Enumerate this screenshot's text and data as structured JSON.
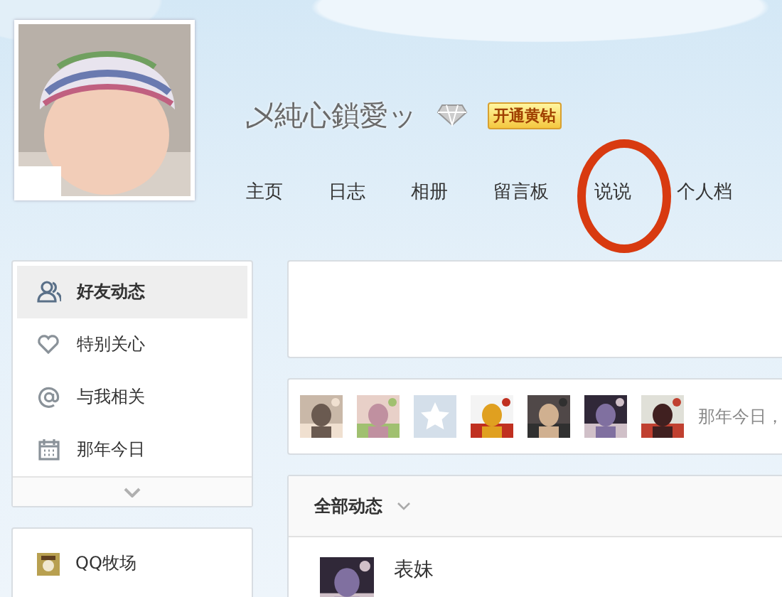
{
  "profile": {
    "name": "乄純心鎖愛ッ",
    "vip_badge": "开通黄钻"
  },
  "nav": [
    {
      "label": "主页",
      "selected": false
    },
    {
      "label": "日志",
      "selected": false
    },
    {
      "label": "相册",
      "selected": false
    },
    {
      "label": "留言板",
      "selected": false
    },
    {
      "label": "说说",
      "selected": false
    },
    {
      "label": "个人档",
      "selected": false
    }
  ],
  "sidebar": {
    "items": [
      {
        "label": "好友动态",
        "selected": true
      },
      {
        "label": "特别关心",
        "selected": false
      },
      {
        "label": "与我相关",
        "selected": false
      },
      {
        "label": "那年今日",
        "selected": false
      }
    ]
  },
  "apps": {
    "items": [
      {
        "label": "QQ牧场"
      }
    ]
  },
  "friend_avatars": [
    {
      "kind": "picture"
    },
    {
      "kind": "picture"
    },
    {
      "kind": "default"
    },
    {
      "kind": "picture"
    },
    {
      "kind": "picture"
    },
    {
      "kind": "picture"
    },
    {
      "kind": "picture"
    }
  ],
  "memory_hint": "那年今日，",
  "feed": {
    "filter": "全部动态",
    "items": [
      {
        "author": "表妹"
      }
    ]
  }
}
